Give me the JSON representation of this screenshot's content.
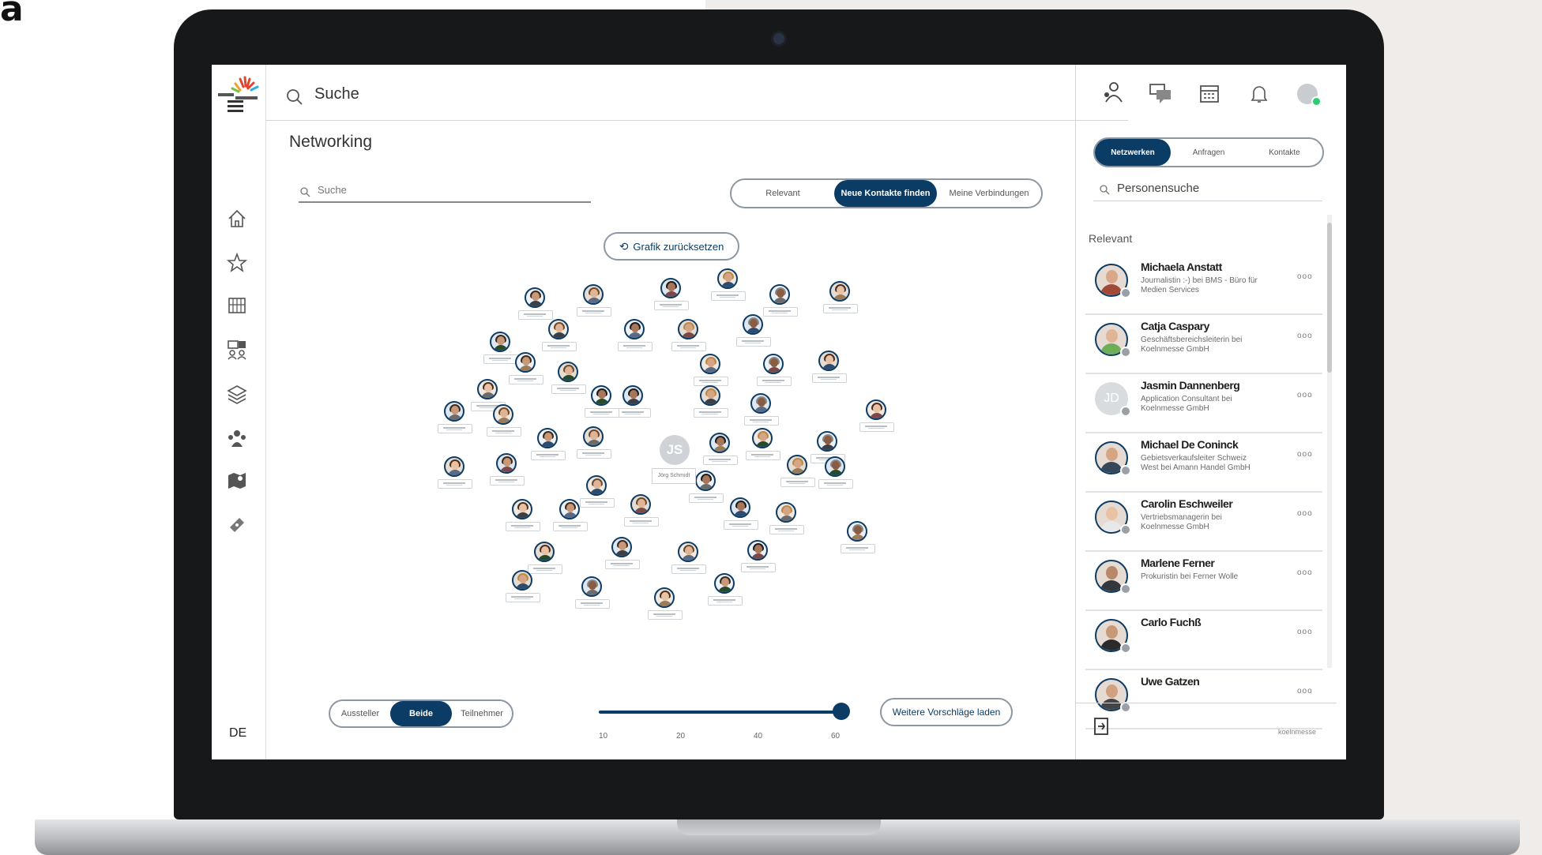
{
  "panel_label": "a",
  "app": {
    "search_placeholder": "Suche",
    "language": "DE"
  },
  "main": {
    "title": "Networking",
    "search_placeholder": "Suche",
    "filter_tabs": [
      "Relevant",
      "Neue Kontakte finden",
      "Meine Verbindungen"
    ],
    "filter_active": "Neue Kontakte finden",
    "reset_button": "Grafik zurücksetzen",
    "center_node": {
      "initials": "JS",
      "label": "Jörg Schmidt"
    },
    "role_tabs": [
      "Aussteller",
      "Beide",
      "Teilnehmer"
    ],
    "role_active": "Beide",
    "slider": {
      "ticks": [
        "10",
        "20",
        "40",
        "60"
      ],
      "value": 60
    },
    "more_button": "Weitere Vorschläge laden"
  },
  "right_panel": {
    "tabs": [
      "Netzwerken",
      "Anfragen",
      "Kontakte"
    ],
    "active_tab": "Netzwerken",
    "search_placeholder": "Personensuche",
    "section_label": "Relevant",
    "people": [
      {
        "name": "Michaela Anstatt",
        "desc": "Journalistin :-) bei BMS - Büro für Medien Services"
      },
      {
        "name": "Catja Caspary",
        "desc": "Geschäftsbereichsleiterin bei Koelnmesse GmbH"
      },
      {
        "name": "Jasmin Dannenberg",
        "desc": "Application Consultant bei Koelnmesse GmbH",
        "initials": "JD"
      },
      {
        "name": "Michael De Coninck",
        "desc": "Gebietsverkaufsleiter Schweiz West bei Amann Handel GmbH"
      },
      {
        "name": "Carolin Eschweiler",
        "desc": "Vertriebsmanagerin bei Koelnmesse GmbH"
      },
      {
        "name": "Marlene Ferner",
        "desc": "Prokuristin bei Ferner Wolle"
      },
      {
        "name": "Carlo Fuchß",
        "desc": ""
      },
      {
        "name": "Uwe Gatzen",
        "desc": ""
      }
    ],
    "more_label": "ooo",
    "brand": "koelnmesse"
  },
  "colors": {
    "accent": "#0b3c66",
    "border": "#8d97a3",
    "online": "#2ecc71"
  }
}
